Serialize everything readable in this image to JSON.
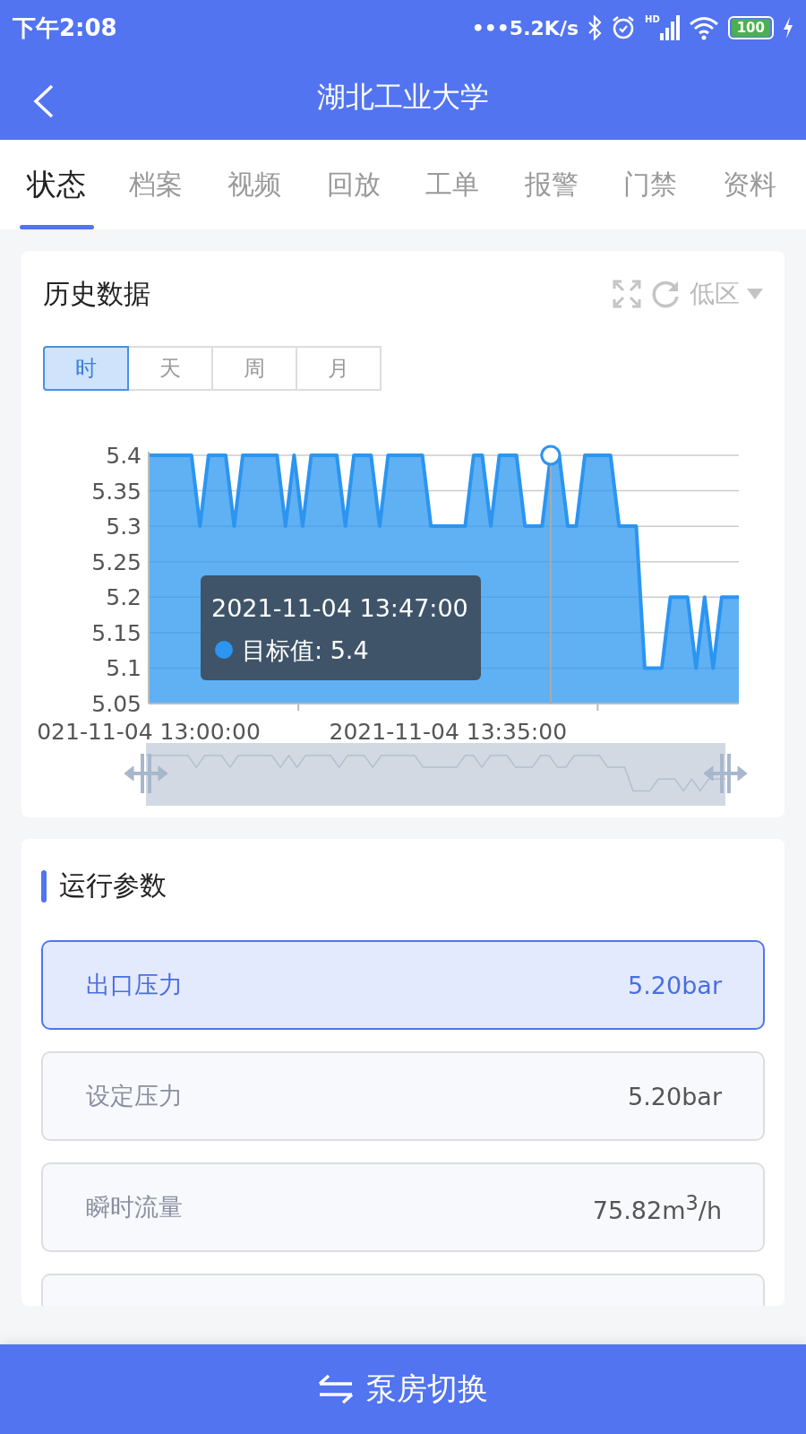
{
  "status_bar": {
    "time": "下午2:08",
    "speed": "•••5.2K/s",
    "signal_label": "HD",
    "battery": "100"
  },
  "header": {
    "title": "湖北工业大学"
  },
  "tabs": [
    {
      "label": "状态",
      "selected": true
    },
    {
      "label": "档案",
      "selected": false
    },
    {
      "label": "视频",
      "selected": false
    },
    {
      "label": "回放",
      "selected": false
    },
    {
      "label": "工单",
      "selected": false
    },
    {
      "label": "报警",
      "selected": false
    },
    {
      "label": "门禁",
      "selected": false
    },
    {
      "label": "资料",
      "selected": false
    }
  ],
  "history": {
    "title": "历史数据",
    "zone": "低区",
    "ranges": [
      {
        "label": "时",
        "selected": true
      },
      {
        "label": "天",
        "selected": false
      },
      {
        "label": "周",
        "selected": false
      },
      {
        "label": "月",
        "selected": false
      }
    ],
    "tooltip": {
      "time": "2021-11-04 13:47:00",
      "text": "目标值: 5.4"
    },
    "chart_data": {
      "type": "area",
      "categories": [
        "021-11-04 13:00:00",
        null,
        null,
        null,
        null,
        null,
        null,
        null,
        null,
        null,
        null,
        null,
        null,
        null,
        null,
        null,
        null,
        null,
        null,
        null,
        null,
        null,
        null,
        null,
        null,
        null,
        null,
        null,
        null,
        null,
        null,
        null,
        null,
        null,
        null,
        "2021-11-04 13:35:00",
        null,
        null,
        null,
        null,
        null,
        null,
        null,
        null,
        null,
        null,
        null,
        null,
        null,
        null,
        null,
        null,
        null,
        null,
        null,
        null,
        null,
        null,
        null,
        null,
        null,
        null,
        null,
        null,
        null,
        null,
        null,
        null,
        null,
        null
      ],
      "series": [
        {
          "color": "#2b95f0",
          "values": [
            5.4,
            5.4,
            5.4,
            5.4,
            5.4,
            5.4,
            5.3,
            5.4,
            5.4,
            5.4,
            5.3,
            5.4,
            5.4,
            5.4,
            5.4,
            5.4,
            5.3,
            5.4,
            5.3,
            5.4,
            5.4,
            5.4,
            5.4,
            5.3,
            5.4,
            5.4,
            5.4,
            5.3,
            5.4,
            5.4,
            5.4,
            5.4,
            5.4,
            5.3,
            5.3,
            5.3,
            5.3,
            5.3,
            5.4,
            5.4,
            5.3,
            5.4,
            5.4,
            5.4,
            5.3,
            5.3,
            5.3,
            5.4,
            5.4,
            5.3,
            5.3,
            5.4,
            5.4,
            5.4,
            5.4,
            5.3,
            5.3,
            5.3,
            5.1,
            5.1,
            5.1,
            5.2,
            5.2,
            5.2,
            5.1,
            5.2,
            5.1,
            5.2,
            5.2,
            5.2
          ]
        }
      ],
      "ylim": [
        5.05,
        5.4
      ],
      "grid": true,
      "yticks": [
        {
          "value": 5.05,
          "label": "5.05"
        },
        {
          "value": 5.1,
          "label": "5.1"
        },
        {
          "value": 5.15,
          "label": "5.15"
        },
        {
          "value": 5.2,
          "label": "5.2"
        },
        {
          "value": 5.25,
          "label": "5.25"
        },
        {
          "value": 5.3,
          "label": "5.3"
        },
        {
          "value": 5.35,
          "label": "5.35"
        },
        {
          "value": 5.4,
          "label": "5.4"
        }
      ]
    }
  },
  "params": {
    "title": "运行参数",
    "rows": [
      {
        "label": "出口压力",
        "value": "5.20bar",
        "selected": true
      },
      {
        "label": "设定压力",
        "value": "5.20bar",
        "selected": false
      },
      {
        "label": "瞬时流量",
        "value": "75.82m$^{3}$/h",
        "selected": false
      },
      {
        "selected": false
      }
    ]
  },
  "bottom_button": {
    "label": "泵房切换"
  }
}
